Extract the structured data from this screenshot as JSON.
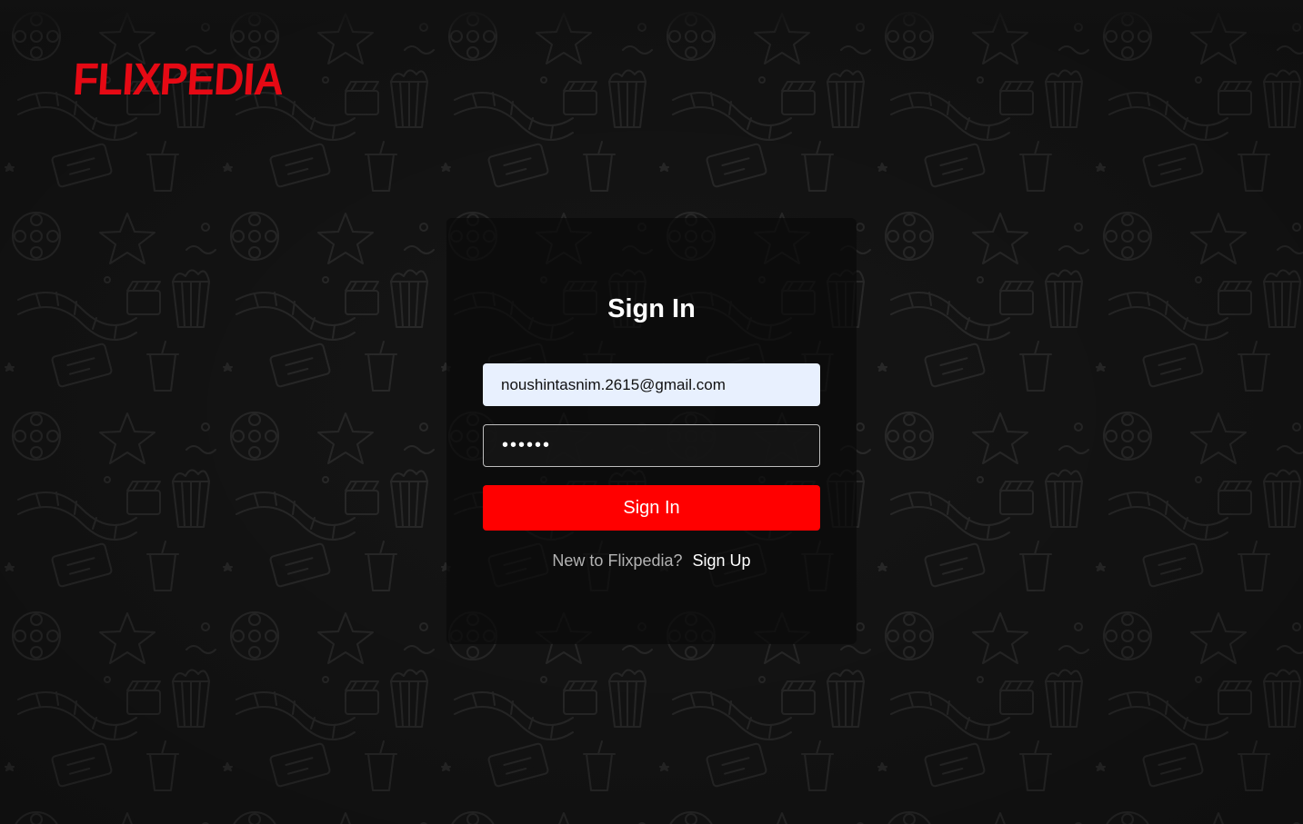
{
  "brand": {
    "logo_text": "FLIXPEDIA",
    "accent_color": "#e50914",
    "button_color": "#ff0000",
    "background_color": "#151515"
  },
  "signin": {
    "title": "Sign In",
    "email_value": "noushintasnim.2615@gmail.com",
    "password_value": "aaaaaa",
    "submit_label": "Sign In",
    "new_prompt": "New to Flixpedia?",
    "signup_label": "Sign Up"
  },
  "background": {
    "pattern": "cinema-doodle-pattern"
  }
}
